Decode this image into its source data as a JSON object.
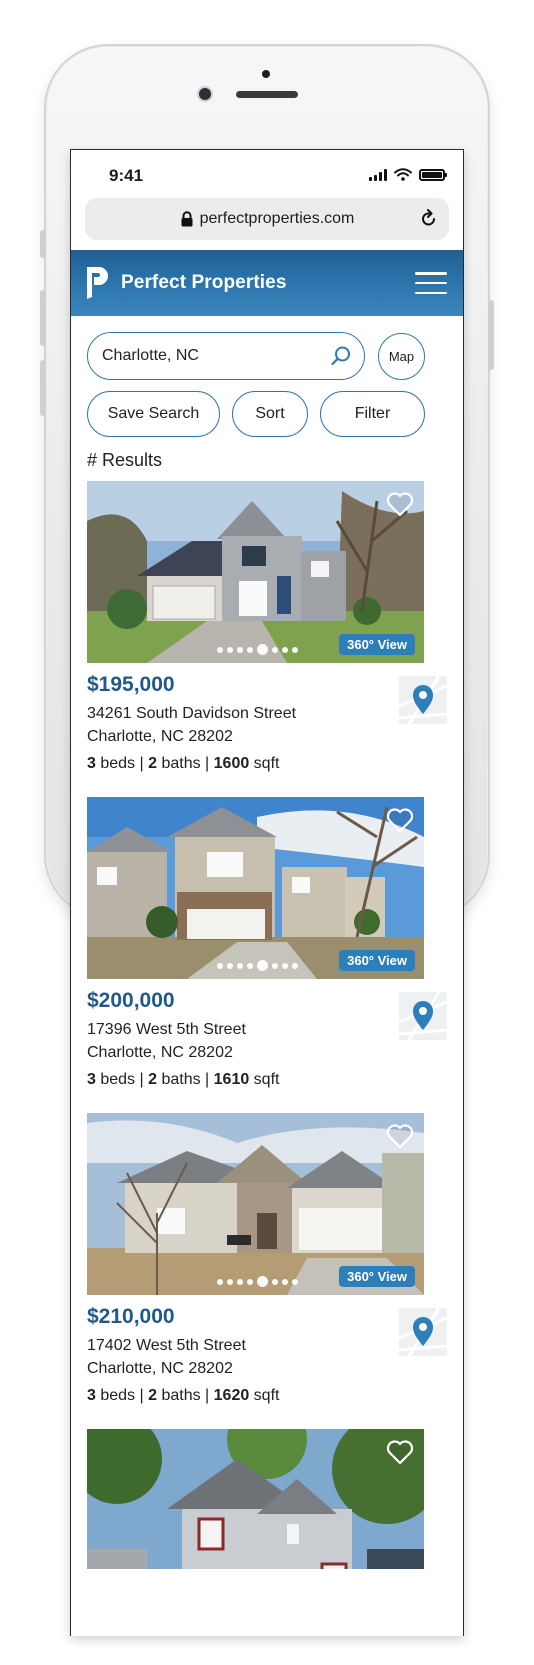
{
  "status": {
    "time": "9:41"
  },
  "browser": {
    "url": "perfectproperties.com"
  },
  "app": {
    "brand": "Perfect Properties"
  },
  "search": {
    "value": "Charlotte, NC",
    "map_label": "Map"
  },
  "actions": {
    "save_search": "Save Search",
    "sort": "Sort",
    "filter": "Filter"
  },
  "results_label": "# Results",
  "badge_360": "360° View",
  "colors": {
    "brand_blue": "#2d77ae",
    "price_blue": "#215a88",
    "badge_blue": "#2c7fb8"
  },
  "listings": [
    {
      "price": "$195,000",
      "street": "34261 South Davidson Street",
      "city": "Charlotte, NC 28202",
      "beds": "3",
      "baths": "2",
      "sqft": "1600"
    },
    {
      "price": "$200,000",
      "street": "17396 West 5th Street",
      "city": "Charlotte, NC 28202",
      "beds": "3",
      "baths": "2",
      "sqft": "1610"
    },
    {
      "price": "$210,000",
      "street": "17402 West 5th Street",
      "city": "Charlotte, NC 28202",
      "beds": "3",
      "baths": "2",
      "sqft": "1620"
    },
    {}
  ],
  "labels": {
    "beds": " beds  |  ",
    "baths": " baths  |  ",
    "sqft": " sqft"
  }
}
